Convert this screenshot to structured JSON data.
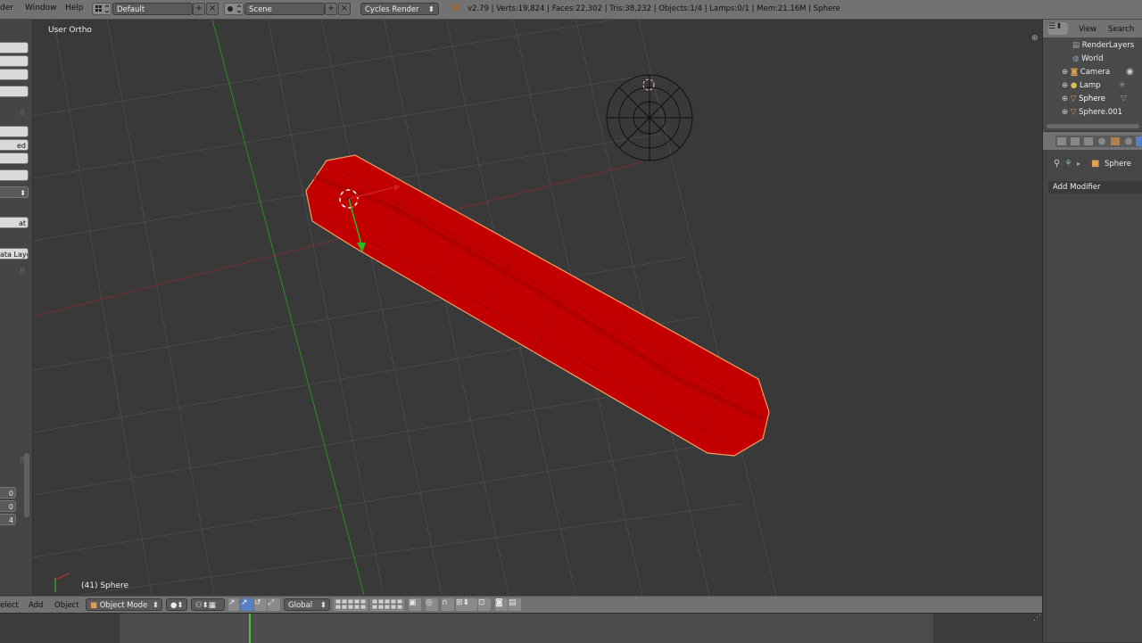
{
  "topbar": {
    "menus": [
      "der",
      "Window",
      "Help"
    ],
    "screen_layout": "Default",
    "scene": "Scene",
    "render_engine": "Cycles Render",
    "stats": "v2.79 | Verts:19,824 | Faces:22,302 | Tris:38,232 | Objects:1/4 | Lamps:0/1 | Mem:21.16M | Sphere"
  },
  "viewport": {
    "view_label": "User Ortho",
    "object_label": "(41) Sphere"
  },
  "shelf": {
    "labels": [
      "",
      "",
      "",
      "",
      "",
      "",
      "ed",
      "",
      "",
      "",
      "at",
      "ata Layo"
    ],
    "numbers": [
      "0",
      "0",
      "4"
    ]
  },
  "view3d_header": {
    "menus": [
      "elect",
      "Add",
      "Object"
    ],
    "mode": "Object Mode",
    "orientation": "Global"
  },
  "outliner": {
    "menus": [
      "View",
      "Search"
    ],
    "items": [
      {
        "label": "RenderLayers",
        "icon": "render-layers-icon"
      },
      {
        "label": "World",
        "icon": "world-icon"
      },
      {
        "label": "Camera",
        "icon": "camera-icon"
      },
      {
        "label": "Lamp",
        "icon": "lamp-icon"
      },
      {
        "label": "Sphere",
        "icon": "mesh-icon",
        "selected": true
      },
      {
        "label": "Sphere.001",
        "icon": "mesh-icon"
      }
    ]
  },
  "properties": {
    "object_name": "Sphere",
    "add_modifier": "Add Modifier"
  },
  "colors": {
    "object_red": "#c00000",
    "selected_outline": "#f0a060",
    "x_axis": "#8a2a2a",
    "y_axis": "#3a8a2a",
    "active_blue": "#5680c2",
    "frame_line": "#44c044"
  }
}
